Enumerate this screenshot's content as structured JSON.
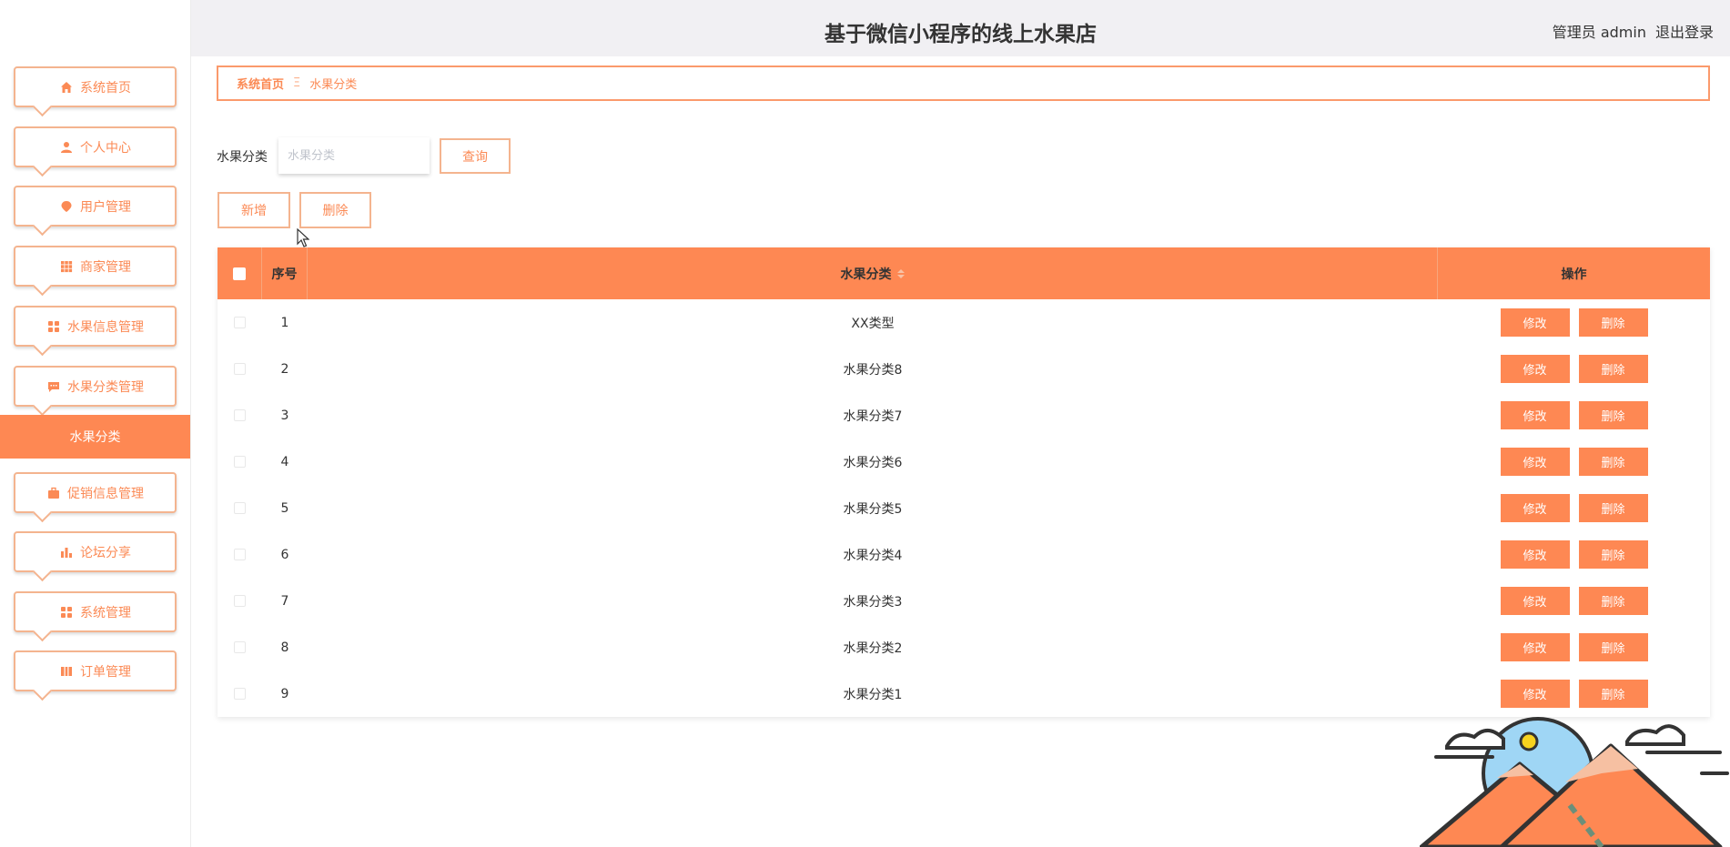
{
  "header": {
    "title": "基于微信小程序的线上水果店",
    "user_label": "管理员 admin",
    "logout_label": "退出登录"
  },
  "sidebar": {
    "items": [
      {
        "label": "系统首页",
        "icon": "home-icon"
      },
      {
        "label": "个人中心",
        "icon": "user-icon"
      },
      {
        "label": "用户管理",
        "icon": "pin-icon"
      },
      {
        "label": "商家管理",
        "icon": "grid-icon"
      },
      {
        "label": "水果信息管理",
        "icon": "apps-icon"
      },
      {
        "label": "水果分类管理",
        "icon": "chat-icon"
      },
      {
        "label": "促销信息管理",
        "icon": "briefcase-icon"
      },
      {
        "label": "论坛分享",
        "icon": "bar-chart-icon"
      },
      {
        "label": "系统管理",
        "icon": "apps-icon"
      },
      {
        "label": "订单管理",
        "icon": "book-icon"
      }
    ],
    "active_sub": "水果分类"
  },
  "breadcrumb": {
    "home": "系统首页",
    "separator": "Ξ",
    "current": "水果分类"
  },
  "search": {
    "label": "水果分类",
    "placeholder": "水果分类",
    "value": "",
    "query_label": "查询"
  },
  "actions": {
    "add_label": "新增",
    "delete_label": "删除"
  },
  "table": {
    "columns": {
      "index": "序号",
      "category": "水果分类",
      "operation": "操作"
    },
    "rows": [
      {
        "index": "1",
        "category": "XX类型"
      },
      {
        "index": "2",
        "category": "水果分类8"
      },
      {
        "index": "3",
        "category": "水果分类7"
      },
      {
        "index": "4",
        "category": "水果分类6"
      },
      {
        "index": "5",
        "category": "水果分类5"
      },
      {
        "index": "6",
        "category": "水果分类4"
      },
      {
        "index": "7",
        "category": "水果分类3"
      },
      {
        "index": "8",
        "category": "水果分类2"
      },
      {
        "index": "9",
        "category": "水果分类1"
      }
    ],
    "row_actions": {
      "edit_label": "修改",
      "delete_label": "删除"
    }
  },
  "colors": {
    "accent": "#fe8853",
    "border": "#f4b48f",
    "header_bg": "#f1f0f3"
  }
}
